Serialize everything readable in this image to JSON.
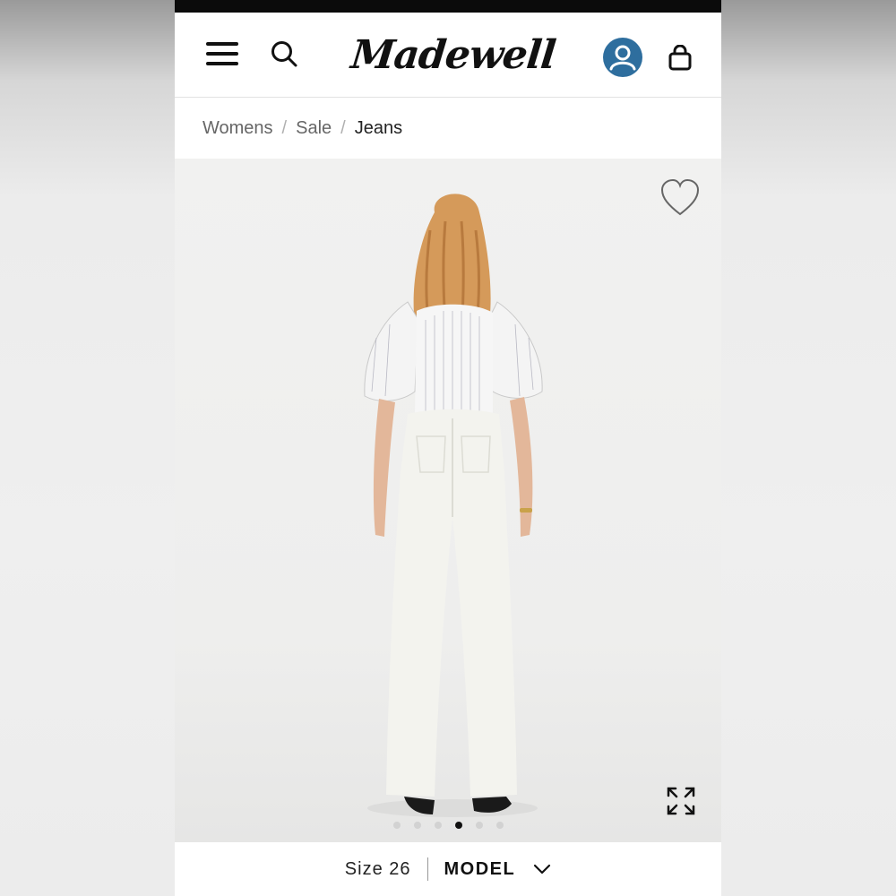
{
  "header": {
    "logo_text": "Madewell"
  },
  "breadcrumb": {
    "items": [
      "Womens",
      "Sale",
      "Jeans"
    ],
    "separator": "/"
  },
  "carousel": {
    "slide_count": 6,
    "active_slide": 4
  },
  "bottom_bar": {
    "size_text": "Size 26",
    "model_label": "MODEL"
  },
  "colors": {
    "account_blue": "#2e6e9e",
    "text_dark": "#111111",
    "pants_white": "#f3f3ee"
  },
  "icons": [
    "menu-icon",
    "search-icon",
    "account-icon",
    "shopping-bag-icon",
    "heart-icon",
    "expand-icon",
    "chevron-down-icon"
  ]
}
